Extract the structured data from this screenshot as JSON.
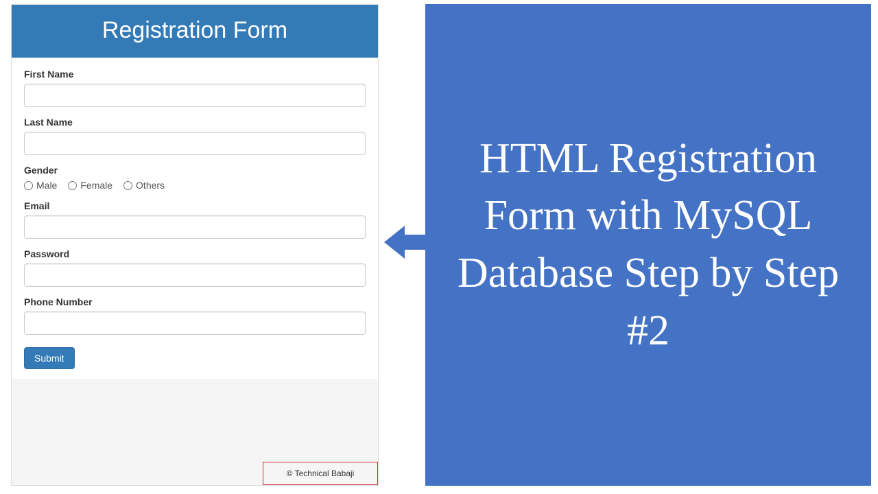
{
  "form": {
    "title": "Registration Form",
    "first_name_label": "First Name",
    "last_name_label": "Last Name",
    "gender_label": "Gender",
    "gender_options": {
      "male": "Male",
      "female": "Female",
      "others": "Others"
    },
    "email_label": "Email",
    "password_label": "Password",
    "phone_label": "Phone Number",
    "submit_label": "Submit",
    "copyright": "© Technical Babaji"
  },
  "promo": {
    "text": "HTML Registration Form with MySQL Database Step by Step #2"
  }
}
